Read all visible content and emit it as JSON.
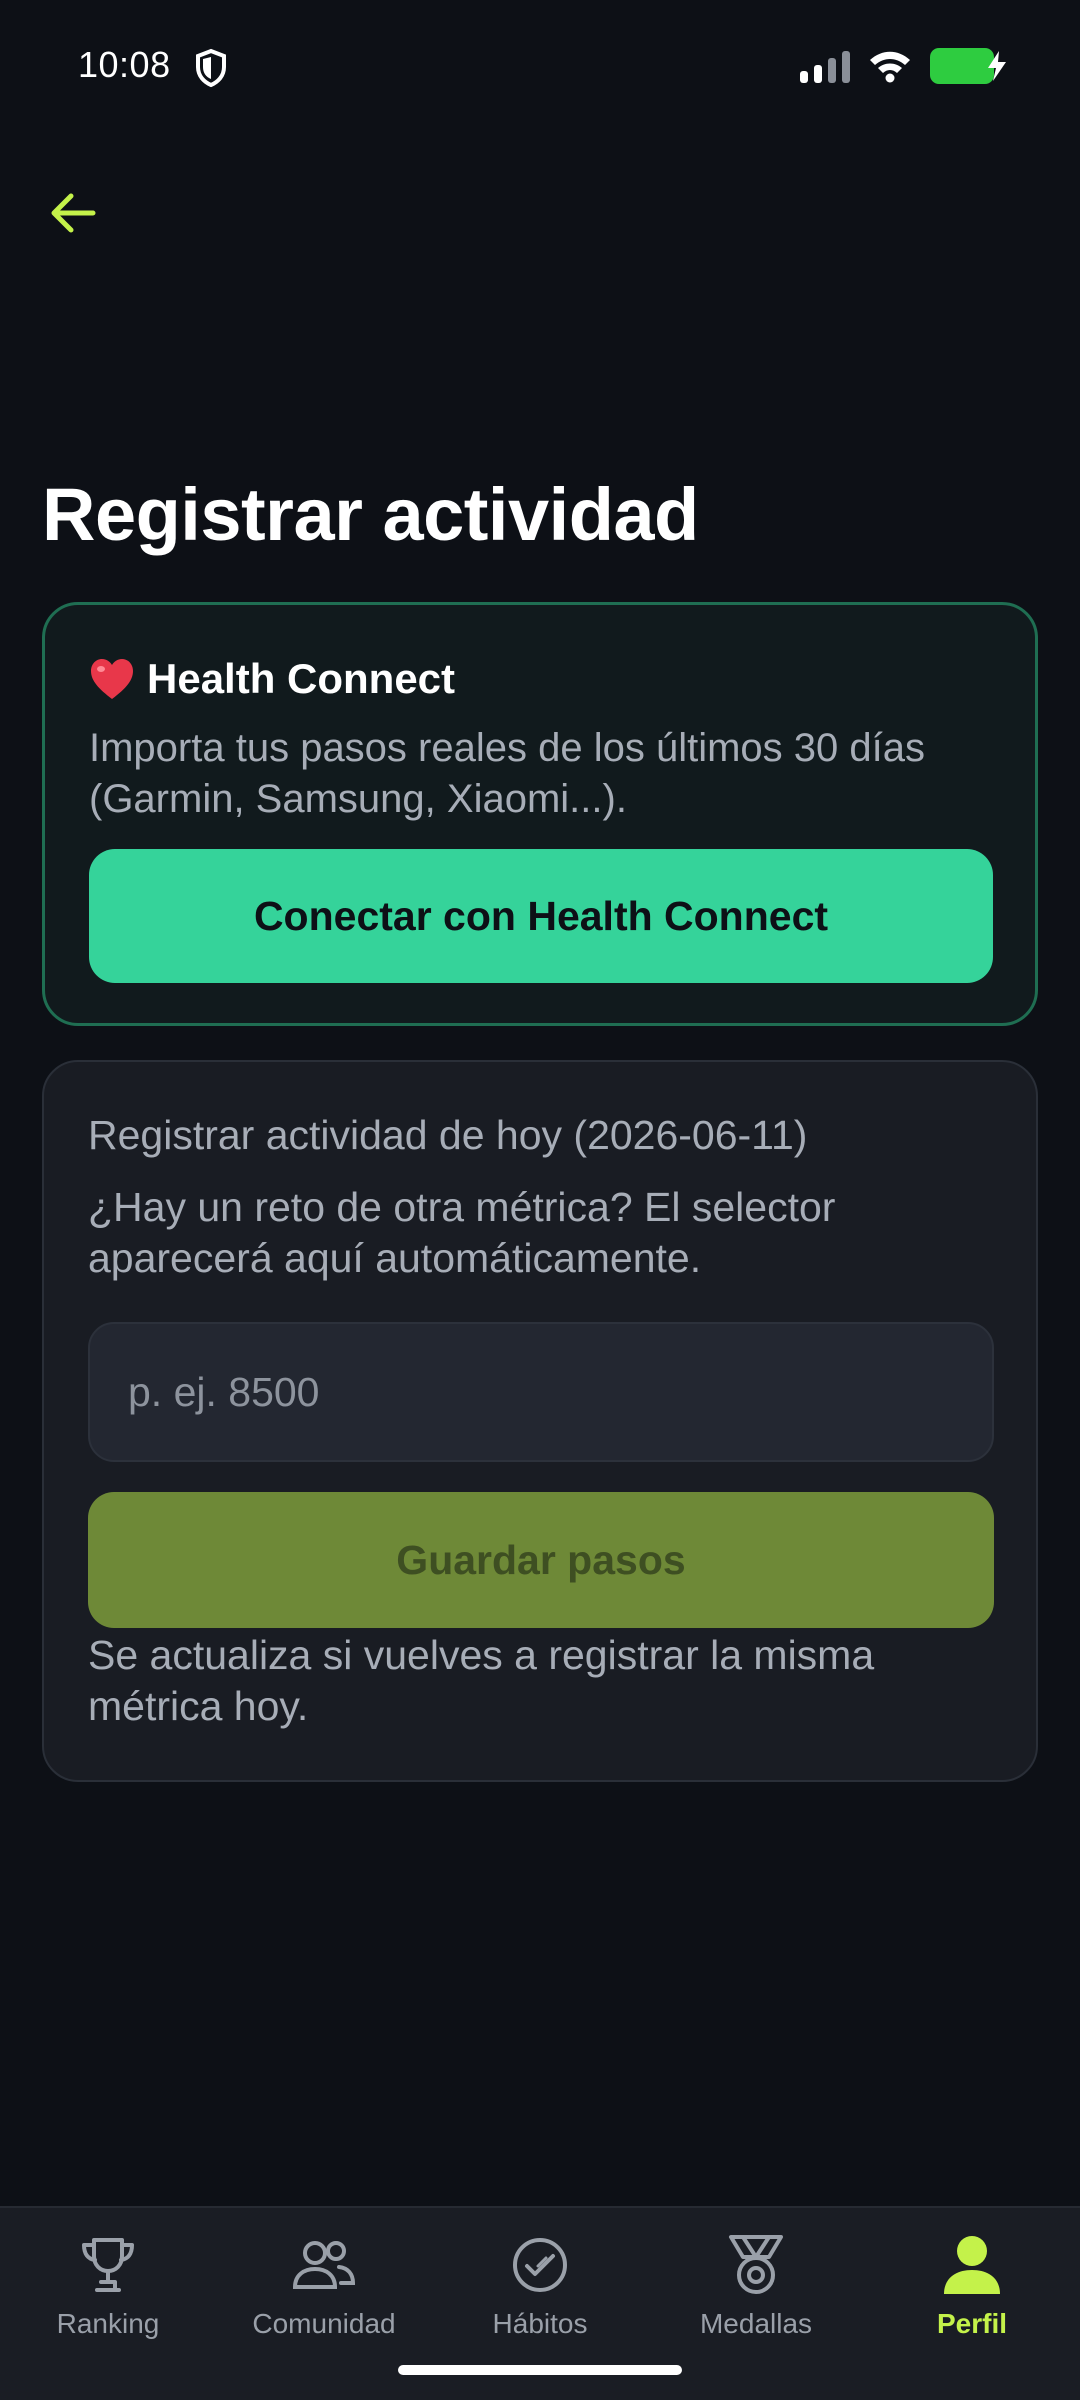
{
  "status_bar": {
    "time": "10:08"
  },
  "header": {
    "title": "Registrar actividad",
    "back_icon": "arrow-left-icon"
  },
  "colors": {
    "accent": "#c4f24a",
    "primary_button": "#35d39a",
    "save_button": "#6e8937",
    "background": "#0d1016",
    "card": "#191c23",
    "battery": "#2ecc40"
  },
  "health_connect": {
    "emoji": "❤️",
    "title": "Health Connect",
    "description": "Importa tus pasos reales de los últimos 30 días (Garmin, Samsung, Xiaomi...).",
    "button_label": "Conectar con Health Connect"
  },
  "log_activity": {
    "heading": "Registrar actividad de hoy (2026-06-11)",
    "hint": "¿Hay un reto de otra métrica? El selector aparecerá aquí automáticamente.",
    "input_value": "",
    "input_placeholder": "p. ej. 8500",
    "save_label": "Guardar pasos",
    "footnote": "Se actualiza si vuelves a registrar la misma métrica hoy."
  },
  "bottom_nav": {
    "items": [
      {
        "label": "Ranking",
        "icon": "trophy-icon"
      },
      {
        "label": "Comunidad",
        "icon": "users-icon"
      },
      {
        "label": "Hábitos",
        "icon": "check-circle-icon"
      },
      {
        "label": "Medallas",
        "icon": "medal-icon"
      },
      {
        "label": "Perfil",
        "icon": "user-icon",
        "active": true
      }
    ]
  }
}
